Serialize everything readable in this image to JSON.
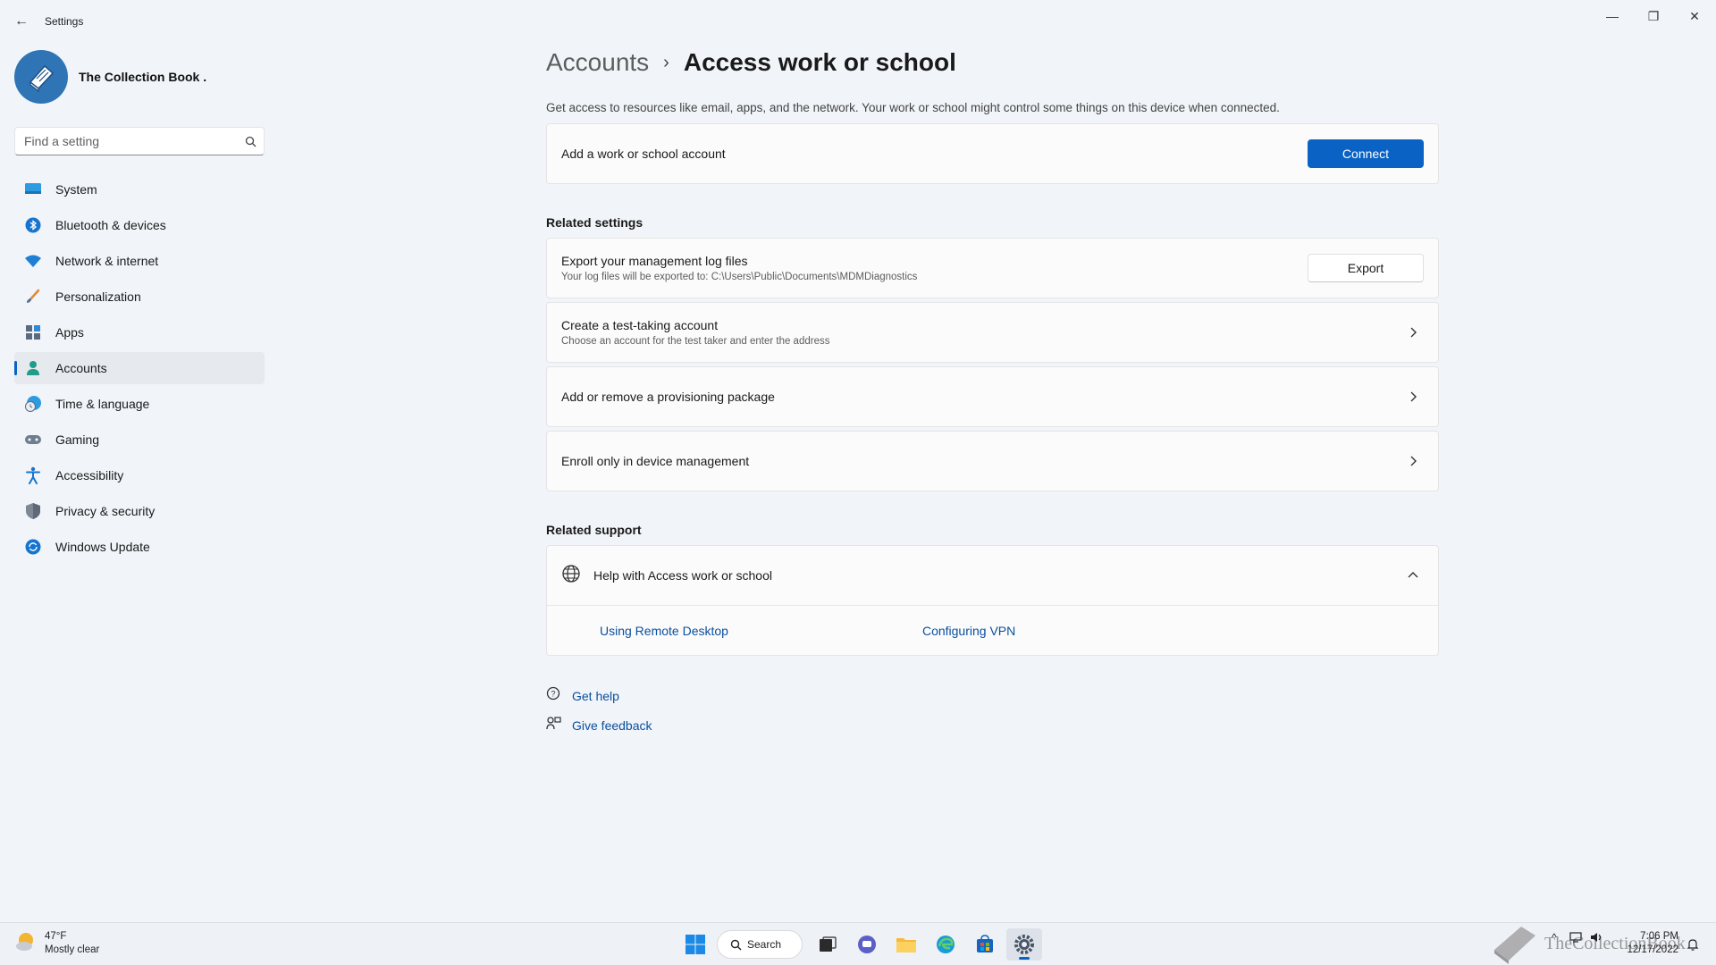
{
  "window": {
    "title": "Settings",
    "back_glyph": "←",
    "minimize_glyph": "—",
    "maximize_glyph": "❐",
    "close_glyph": "✕"
  },
  "profile": {
    "name": "The Collection Book ."
  },
  "search": {
    "placeholder": "Find a setting"
  },
  "nav": {
    "items": [
      {
        "label": "System",
        "icon": "monitor-icon"
      },
      {
        "label": "Bluetooth & devices",
        "icon": "bluetooth-icon"
      },
      {
        "label": "Network & internet",
        "icon": "wifi-icon"
      },
      {
        "label": "Personalization",
        "icon": "brush-icon"
      },
      {
        "label": "Apps",
        "icon": "apps-icon"
      },
      {
        "label": "Accounts",
        "icon": "person-icon",
        "active": true
      },
      {
        "label": "Time & language",
        "icon": "globe-clock-icon"
      },
      {
        "label": "Gaming",
        "icon": "gamepad-icon"
      },
      {
        "label": "Accessibility",
        "icon": "accessibility-icon"
      },
      {
        "label": "Privacy & security",
        "icon": "shield-icon"
      },
      {
        "label": "Windows Update",
        "icon": "update-icon"
      }
    ]
  },
  "breadcrumb": {
    "parent": "Accounts",
    "separator": "›",
    "current": "Access work or school"
  },
  "page": {
    "description": "Get access to resources like email, apps, and the network. Your work or school might control some things on this device when connected."
  },
  "add_account": {
    "title": "Add a work or school account",
    "button": "Connect"
  },
  "related_settings": {
    "heading": "Related settings",
    "export": {
      "title": "Export your management log files",
      "subtitle": "Your log files will be exported to: C:\\Users\\Public\\Documents\\MDMDiagnostics",
      "button": "Export"
    },
    "test_account": {
      "title": "Create a test-taking account",
      "subtitle": "Choose an account for the test taker and enter the address"
    },
    "provisioning": {
      "title": "Add or remove a provisioning package"
    },
    "enroll": {
      "title": "Enroll only in device management"
    }
  },
  "related_support": {
    "heading": "Related support",
    "help_title": "Help with Access work or school",
    "links": [
      "Using Remote Desktop",
      "Configuring VPN"
    ]
  },
  "footer": {
    "get_help": "Get help",
    "give_feedback": "Give feedback"
  },
  "taskbar": {
    "weather_temp": "47°F",
    "weather_desc": "Mostly clear",
    "search_label": "Search",
    "time": "7:06 PM",
    "date": "12/17/2022",
    "watermark": "TheCollectionBook",
    "tray_chevron": "^"
  },
  "colors": {
    "accent": "#0a63c4",
    "link": "#0a4f9e",
    "background": "#f1f4f9"
  }
}
